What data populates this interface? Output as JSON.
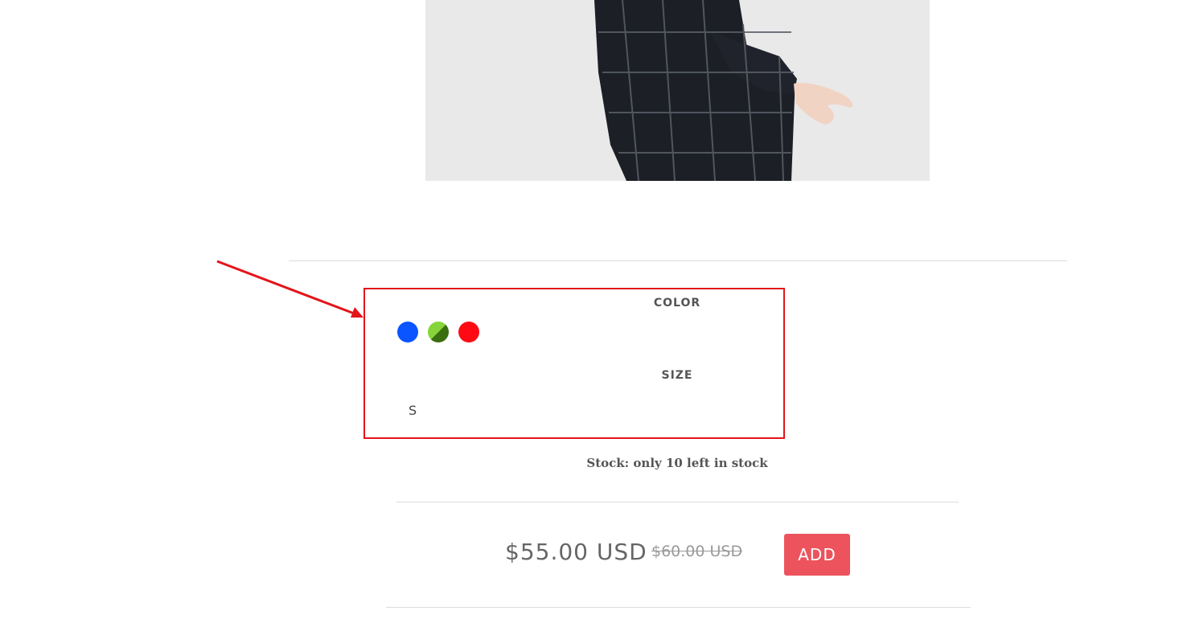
{
  "product": {
    "image_alt": "Model wearing a dark plaid checked dress"
  },
  "options": {
    "color_label": "COLOR",
    "colors": [
      {
        "name": "blue",
        "hex": "#0a55ff"
      },
      {
        "name": "green",
        "hex": "#86d43a"
      },
      {
        "name": "red",
        "hex": "#ff0a14"
      }
    ],
    "size_label": "SIZE",
    "sizes": [
      "S"
    ]
  },
  "stock": {
    "text": "Stock: only 10 left in stock"
  },
  "pricing": {
    "current": "$55.00 USD",
    "original": "$60.00 USD"
  },
  "cart": {
    "add_label": "ADD"
  },
  "annotation": {
    "color": "#e3151a"
  },
  "theme": {
    "accent": "#ec535d"
  }
}
